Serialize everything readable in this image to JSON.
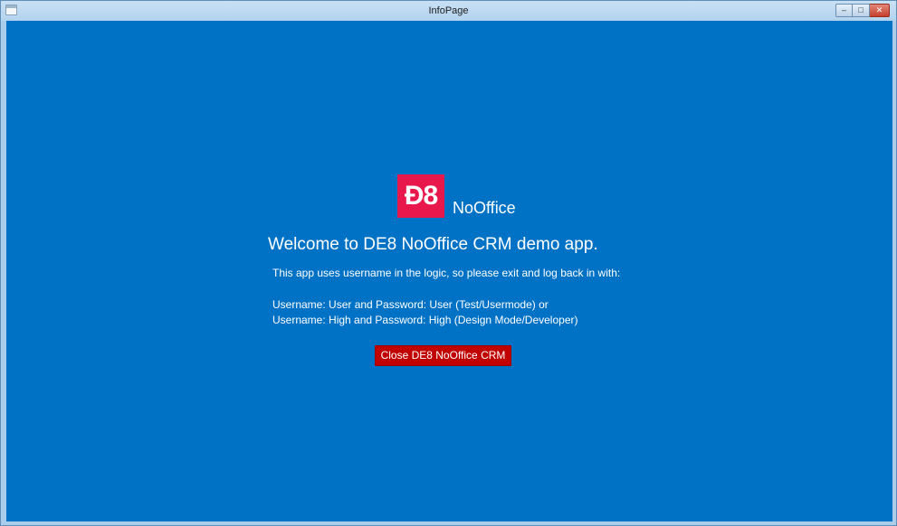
{
  "window": {
    "title": "InfoPage",
    "controls": {
      "minimize_symbol": "‒",
      "maximize_symbol": "□",
      "close_symbol": "✕"
    }
  },
  "content": {
    "logo_text": "Ð8",
    "brand_name": "NoOffice",
    "welcome": "Welcome to DE8 NoOffice CRM demo app.",
    "info": "This app uses username in the logic, so please exit and log back in with:",
    "credentials": [
      "Username: User and Password: User (Test/Usermode) or",
      "Username: High and Password: High (Design Mode/Developer)"
    ],
    "close_button_label": "Close DE8 NoOffice CRM"
  },
  "colors": {
    "background": "#0072c6",
    "logo": "#e8174c",
    "close_button": "#c10000"
  }
}
